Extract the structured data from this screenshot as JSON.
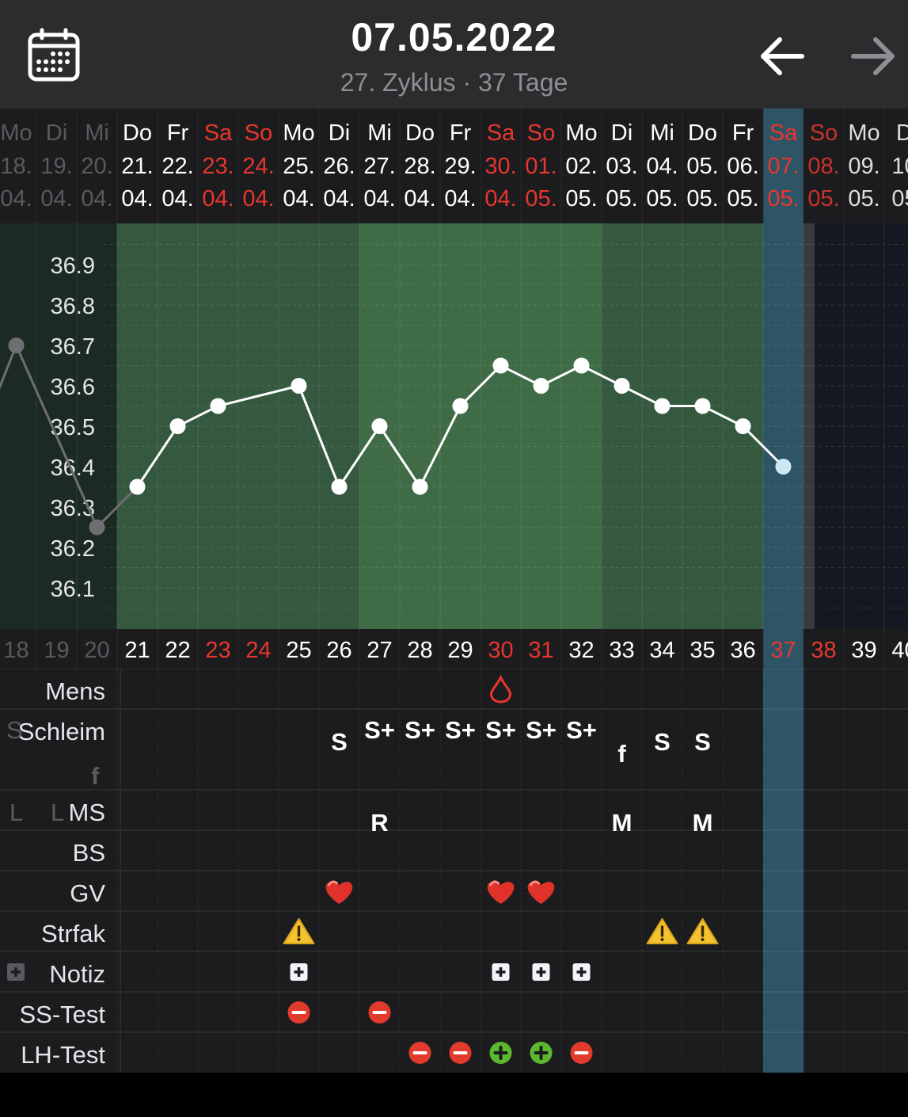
{
  "header": {
    "title": "07.05.2022",
    "subtitle": "27. Zyklus · 37 Tage",
    "calendar_icon": "calendar-icon",
    "prev_icon": "arrow-left-icon",
    "next_icon": "arrow-right-icon"
  },
  "colors": {
    "weekend": "#e8362e",
    "fertile": "#35593f",
    "fertile_peak": "#3f6b47",
    "today": "#2e5566",
    "dimmed": "#5a5a5e"
  },
  "columns": [
    {
      "wd": "Mo",
      "d": "18.",
      "m": "04.",
      "n": "18",
      "weekend": false,
      "prev": true
    },
    {
      "wd": "Di",
      "d": "19.",
      "m": "04.",
      "n": "19",
      "weekend": false,
      "prev": true
    },
    {
      "wd": "Mi",
      "d": "20.",
      "m": "04.",
      "n": "20",
      "weekend": false,
      "prev": true
    },
    {
      "wd": "Do",
      "d": "21.",
      "m": "04.",
      "n": "21",
      "weekend": false
    },
    {
      "wd": "Fr",
      "d": "22.",
      "m": "04.",
      "n": "22",
      "weekend": false
    },
    {
      "wd": "Sa",
      "d": "23.",
      "m": "04.",
      "n": "23",
      "weekend": true
    },
    {
      "wd": "So",
      "d": "24.",
      "m": "04.",
      "n": "24",
      "weekend": true
    },
    {
      "wd": "Mo",
      "d": "25.",
      "m": "04.",
      "n": "25",
      "weekend": false
    },
    {
      "wd": "Di",
      "d": "26.",
      "m": "04.",
      "n": "26",
      "weekend": false
    },
    {
      "wd": "Mi",
      "d": "27.",
      "m": "04.",
      "n": "27",
      "weekend": false
    },
    {
      "wd": "Do",
      "d": "28.",
      "m": "04.",
      "n": "28",
      "weekend": false
    },
    {
      "wd": "Fr",
      "d": "29.",
      "m": "04.",
      "n": "29",
      "weekend": false
    },
    {
      "wd": "Sa",
      "d": "30.",
      "m": "04.",
      "n": "30",
      "weekend": true
    },
    {
      "wd": "So",
      "d": "01.",
      "m": "05.",
      "n": "31",
      "weekend": true
    },
    {
      "wd": "Mo",
      "d": "02.",
      "m": "05.",
      "n": "32",
      "weekend": false
    },
    {
      "wd": "Di",
      "d": "03.",
      "m": "05.",
      "n": "33",
      "weekend": false
    },
    {
      "wd": "Mi",
      "d": "04.",
      "m": "05.",
      "n": "34",
      "weekend": false
    },
    {
      "wd": "Do",
      "d": "05.",
      "m": "05.",
      "n": "35",
      "weekend": false
    },
    {
      "wd": "Fr",
      "d": "06.",
      "m": "05.",
      "n": "36",
      "weekend": false
    },
    {
      "wd": "Sa",
      "d": "07.",
      "m": "05.",
      "n": "37",
      "weekend": true,
      "today": true
    },
    {
      "wd": "So",
      "d": "08.",
      "m": "05.",
      "n": "38",
      "weekend": true,
      "future": true
    },
    {
      "wd": "Mo",
      "d": "09.",
      "m": "05.",
      "n": "39",
      "weekend": false,
      "future": true
    },
    {
      "wd": "D",
      "d": "10",
      "m": "05",
      "n": "40",
      "weekend": false,
      "future": true
    }
  ],
  "chart_data": {
    "type": "line",
    "y_ticks": [
      "36.9",
      "36.8",
      "36.7",
      "36.6",
      "36.5",
      "36.4",
      "36.3",
      "36.2",
      "36.1"
    ],
    "ylim": [
      36.0,
      37.0
    ],
    "previous_cycle_points": [
      {
        "col": 0,
        "y": 36.7
      },
      {
        "col": 2,
        "y": 36.25
      }
    ],
    "series": [
      {
        "x": [
          3,
          4,
          5,
          7,
          8,
          9,
          10,
          11,
          12,
          13,
          14,
          15,
          16,
          17,
          18,
          19
        ],
        "y": [
          36.35,
          36.5,
          36.55,
          36.6,
          36.35,
          36.5,
          36.35,
          36.55,
          36.65,
          36.6,
          36.65,
          36.6,
          36.55,
          36.55,
          36.5,
          36.4
        ]
      }
    ],
    "fertile_range": [
      3,
      18
    ],
    "peak_range": [
      9,
      14
    ],
    "today_col": 19
  },
  "rows": [
    {
      "key": "mens",
      "label": "Mens",
      "ghost": "",
      "entries": [
        {
          "col": 12,
          "type": "drop"
        }
      ]
    },
    {
      "key": "schleim",
      "label": "Schleim",
      "ghost": "S",
      "ghost2": "f",
      "entries": [
        {
          "col": 8,
          "text": "S"
        },
        {
          "col": 9,
          "text": "S+",
          "high": true
        },
        {
          "col": 10,
          "text": "S+",
          "high": true
        },
        {
          "col": 11,
          "text": "S+",
          "high": true
        },
        {
          "col": 12,
          "text": "S+",
          "high": true
        },
        {
          "col": 13,
          "text": "S+",
          "high": true
        },
        {
          "col": 14,
          "text": "S+",
          "high": true
        },
        {
          "col": 15,
          "text": "f",
          "low": true
        },
        {
          "col": 16,
          "text": "S"
        },
        {
          "col": 17,
          "text": "S"
        }
      ]
    },
    {
      "key": "lms",
      "label": "MS",
      "ghost": "L",
      "ghost_inline": "L",
      "entries": [
        {
          "col": 9,
          "text": "R"
        },
        {
          "col": 15,
          "text": "M"
        },
        {
          "col": 17,
          "text": "M"
        }
      ]
    },
    {
      "key": "bs",
      "label": "BS",
      "ghost": "",
      "entries": []
    },
    {
      "key": "gv",
      "label": "GV",
      "ghost": "",
      "entries": [
        {
          "col": 8,
          "type": "heart"
        },
        {
          "col": 12,
          "type": "heart"
        },
        {
          "col": 13,
          "type": "heart"
        }
      ]
    },
    {
      "key": "strfak",
      "label": "Strfak",
      "ghost": "",
      "entries": [
        {
          "col": 7,
          "type": "warning"
        },
        {
          "col": 16,
          "type": "warning"
        },
        {
          "col": 17,
          "type": "warning"
        }
      ]
    },
    {
      "key": "notiz",
      "label": "Notiz",
      "ghost": "plus",
      "entries": [
        {
          "col": 7,
          "type": "note"
        },
        {
          "col": 12,
          "type": "note"
        },
        {
          "col": 13,
          "type": "note"
        },
        {
          "col": 14,
          "type": "note"
        }
      ]
    },
    {
      "key": "sstest",
      "label": "SS-Test",
      "ghost": "",
      "entries": [
        {
          "col": 7,
          "type": "minus"
        },
        {
          "col": 9,
          "type": "minus"
        }
      ]
    },
    {
      "key": "lhtest",
      "label": "LH-Test",
      "ghost": "",
      "entries": [
        {
          "col": 10,
          "type": "minus"
        },
        {
          "col": 11,
          "type": "minus"
        },
        {
          "col": 12,
          "type": "plus"
        },
        {
          "col": 13,
          "type": "plus"
        },
        {
          "col": 14,
          "type": "minus"
        }
      ]
    }
  ]
}
